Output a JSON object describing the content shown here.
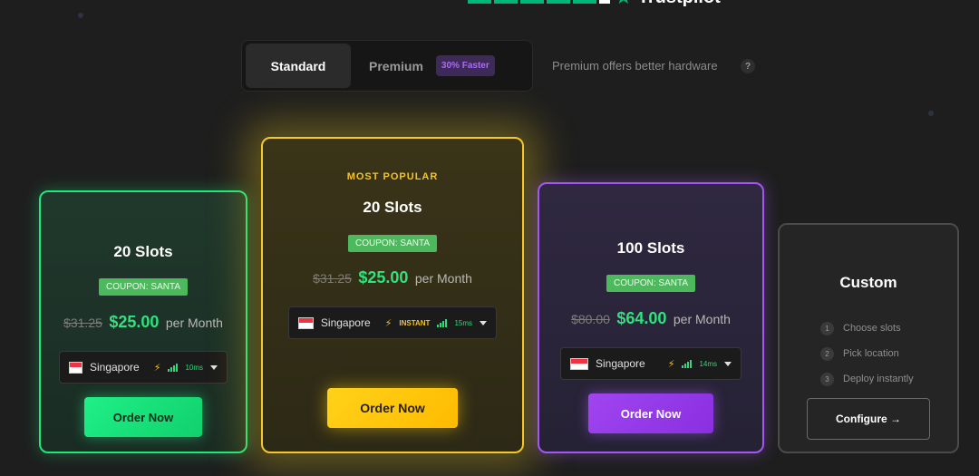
{
  "trustpilot": {
    "brand": "Trustpilot",
    "star_glyph": "★"
  },
  "toggle": {
    "standard_label": "Standard",
    "premium_label": "Premium",
    "premium_badge": "30% Faster",
    "hint": "Premium offers better hardware",
    "help_glyph": "?"
  },
  "plans": [
    {
      "slots": "20 Slots",
      "coupon": "COUPON: SANTA",
      "old_price": "$31.25",
      "price": "$25.00",
      "period": "per Month",
      "location": "Singapore",
      "ping": "10ms",
      "button": "Order Now",
      "accent": "#1ee87a"
    },
    {
      "tag": "MOST POPULAR",
      "slots": "20 Slots",
      "coupon": "COUPON: SANTA",
      "old_price": "$31.25",
      "price": "$25.00",
      "period": "per Month",
      "location": "Singapore",
      "speed": "INSTANT",
      "ping": "15ms",
      "button": "Order Now",
      "accent": "#f6c928"
    },
    {
      "slots": "100 Slots",
      "coupon": "COUPON: SANTA",
      "old_price": "$80.00",
      "price": "$64.00",
      "period": "per Month",
      "location": "Singapore",
      "ping": "14ms",
      "button": "Order Now",
      "accent": "#a357f4"
    }
  ],
  "custom": {
    "title": "Custom",
    "steps": [
      {
        "num": "1",
        "text": "Choose slots"
      },
      {
        "num": "2",
        "text": "Pick location"
      },
      {
        "num": "3",
        "text": "Deploy instantly"
      }
    ],
    "button": "Configure →"
  },
  "icons": {
    "bolt": "⚡"
  }
}
